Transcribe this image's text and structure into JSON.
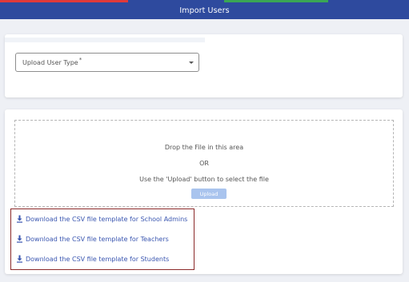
{
  "colors": {
    "header_bg": "#2e4a9e",
    "link": "#3a56b0",
    "upload_button_bg": "#a9c4ee",
    "highlight_border": "#8b2a2a",
    "top_stripe": [
      "#e03a3a",
      "#2e4a9e",
      "#3aa655",
      "#2e4a9e"
    ]
  },
  "header": {
    "title": "Import Users"
  },
  "user_type_select": {
    "label": "Upload User Type",
    "required_mark": "*",
    "icon": "caret-down-icon"
  },
  "dropzone": {
    "line1": "Drop the File in this area",
    "line2": "OR",
    "line3": "Use the 'Upload' button to select the file",
    "upload_button": "Upload"
  },
  "downloads": {
    "icon": "download-icon",
    "items": [
      {
        "label": "Download the CSV file template for School Admins"
      },
      {
        "label": "Download the CSV file template for Teachers"
      },
      {
        "label": "Download the CSV file template for Students"
      }
    ]
  }
}
